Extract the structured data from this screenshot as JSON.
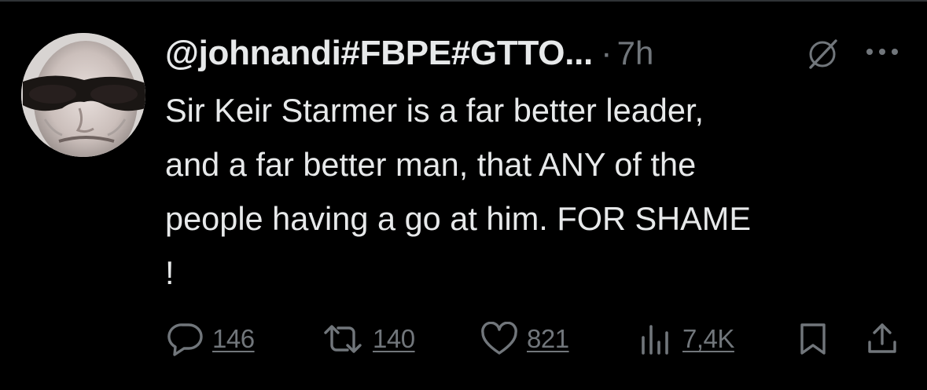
{
  "tweet": {
    "handle": "@johnandi#FBPE#GTTO...",
    "separator": "·",
    "time": "7h",
    "text": "Sir Keir Starmer is a far better leader,\nand a far better man, that ANY of the\npeople having a go at him. FOR SHAME\n!"
  },
  "actions": {
    "replies": "146",
    "reposts": "140",
    "likes": "821",
    "views": "7,4K"
  },
  "icons": {
    "avatar": "profile-photo-man-sunglasses",
    "grok": "grok-icon",
    "more": "more-dots-icon",
    "reply": "speech-bubble-icon",
    "repost": "repost-arrows-icon",
    "like": "heart-icon",
    "views": "bar-chart-icon",
    "bookmark": "bookmark-icon",
    "share": "share-upload-icon"
  },
  "colors": {
    "background": "#000000",
    "text": "#e7e9ea",
    "muted": "#71767b",
    "divider": "#2f3336"
  }
}
